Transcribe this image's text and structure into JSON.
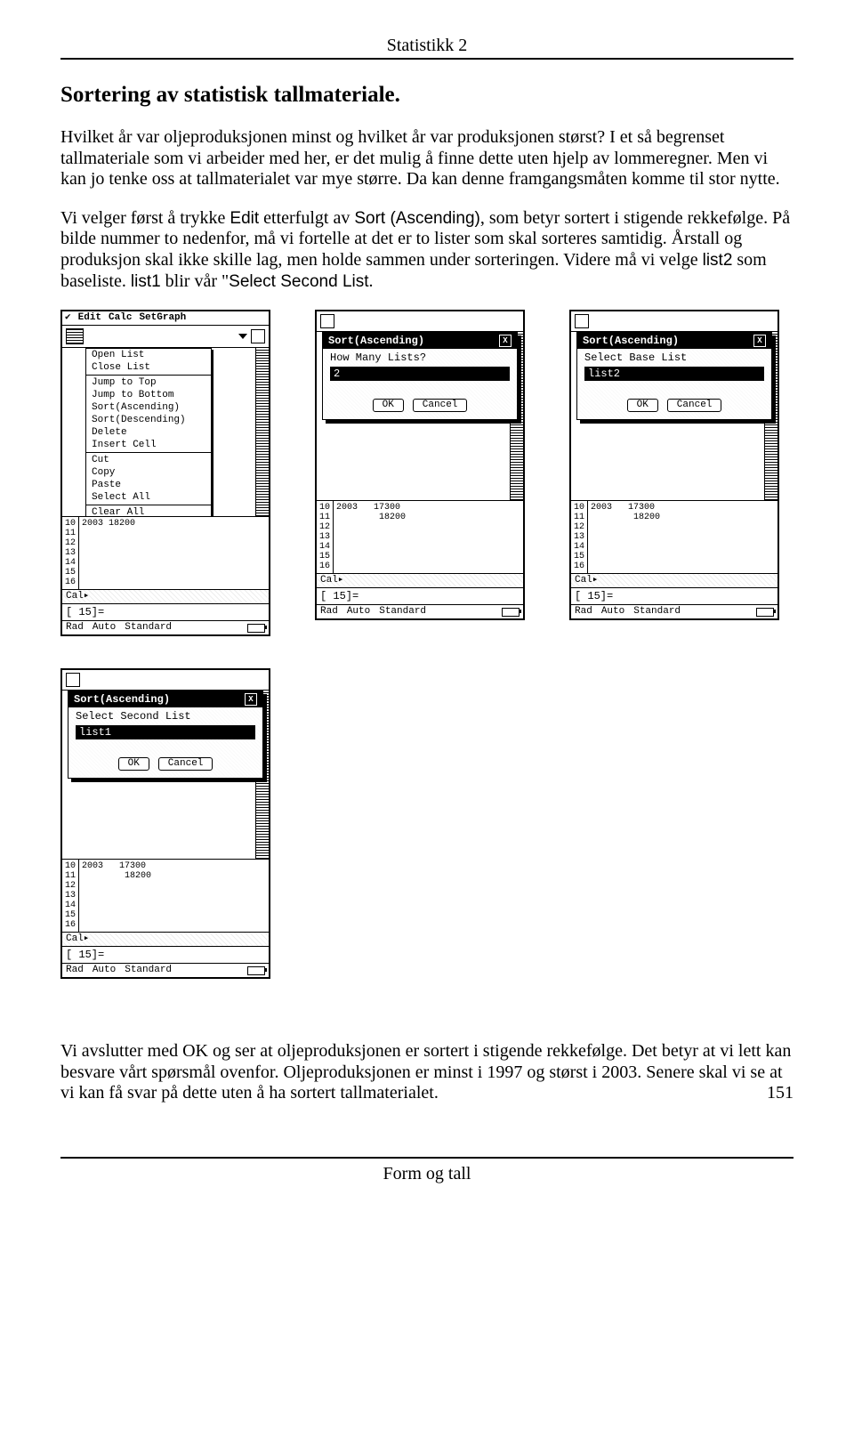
{
  "header": {
    "title": "Statistikk 2"
  },
  "section": {
    "title": "Sortering av statistisk tallmateriale."
  },
  "para1": "Hvilket år var oljeproduksjonen minst og hvilket år var produksjonen størst? I et så begrenset tallmateriale som vi arbeider med her, er det mulig å finne dette uten hjelp av lommeregner. Men vi kan jo tenke oss at tallmaterialet var mye større. Da kan denne framgangsmåten komme til stor nytte.",
  "para2a": "Vi velger først å trykke ",
  "para2_edit": "Edit",
  "para2b": " etterfulgt av ",
  "para2_sort": "Sort (Ascending)",
  "para2c": ", som betyr sortert i stigende rekkefølge. På bilde nummer to nedenfor, må vi fortelle at det er to lister som skal sorteres samtidig. Årstall og produksjon skal ikke skille lag, men holde sammen under sorteringen. Videre må vi velge ",
  "para2_list2": "list2",
  "para2d": " som baseliste. ",
  "para2_list1": "list1",
  "para2e": " blir vår \"",
  "para2_ssl": "Select Second List",
  "para2f": ".",
  "screen1": {
    "menubar": [
      "Edit",
      "Calc",
      "SetGraph"
    ],
    "dropdown_items": [
      "Open List",
      "Close List",
      "—",
      "Jump to Top",
      "Jump to Bottom",
      "Sort(Ascending)",
      "Sort(Descending)",
      "Delete",
      "Insert Cell",
      "—",
      "Cut",
      "Copy",
      "Paste",
      "Select All",
      "—",
      "Clear All"
    ],
    "rows": [
      "10",
      "11",
      "12",
      "13",
      "14",
      "15",
      "16"
    ],
    "cols": [
      "2003   18200"
    ],
    "cal": "Cal▸",
    "input": "[  15]=",
    "status": [
      "Rad",
      "Auto",
      "Standard"
    ]
  },
  "screen2": {
    "title": "Sort(Ascending)",
    "label": "How Many Lists?",
    "value": "2",
    "btn_ok": "OK",
    "btn_cancel": "Cancel",
    "rows": [
      "10",
      "11",
      "12",
      "13",
      "14",
      "15",
      "16"
    ],
    "col_yr": "2003",
    "col_v1": "17300",
    "col_v2": "18200",
    "cal": "Cal▸",
    "input": "[  15]=",
    "status": [
      "Rad",
      "Auto",
      "Standard"
    ]
  },
  "screen3": {
    "title": "Sort(Ascending)",
    "label": "Select Base List",
    "value": "list2",
    "btn_ok": "OK",
    "btn_cancel": "Cancel",
    "rows": [
      "10",
      "11",
      "12",
      "13",
      "14",
      "15",
      "16"
    ],
    "col_yr": "2003",
    "col_v1": "17300",
    "col_v2": "18200",
    "cal": "Cal▸",
    "input": "[  15]=",
    "status": [
      "Rad",
      "Auto",
      "Standard"
    ]
  },
  "screen4": {
    "title": "Sort(Ascending)",
    "label": "Select Second List",
    "value": "list1",
    "btn_ok": "OK",
    "btn_cancel": "Cancel",
    "rows": [
      "10",
      "11",
      "12",
      "13",
      "14",
      "15",
      "16"
    ],
    "col_yr": "2003",
    "col_v1": "17300",
    "col_v2": "18200",
    "cal": "Cal▸",
    "input": "[  15]=",
    "status": [
      "Rad",
      "Auto",
      "Standard"
    ]
  },
  "para3": "Vi avslutter med OK og ser at oljeproduksjonen er sortert i stigende rekkefølge. Det betyr at vi lett kan besvare vårt spørsmål ovenfor. Oljeproduksjonen er minst i 1997 og størst i 2003. Senere skal vi se at vi kan få svar på dette uten å ha sortert tallmaterialet.",
  "footer": {
    "text": "Form og tall",
    "page": "151"
  }
}
